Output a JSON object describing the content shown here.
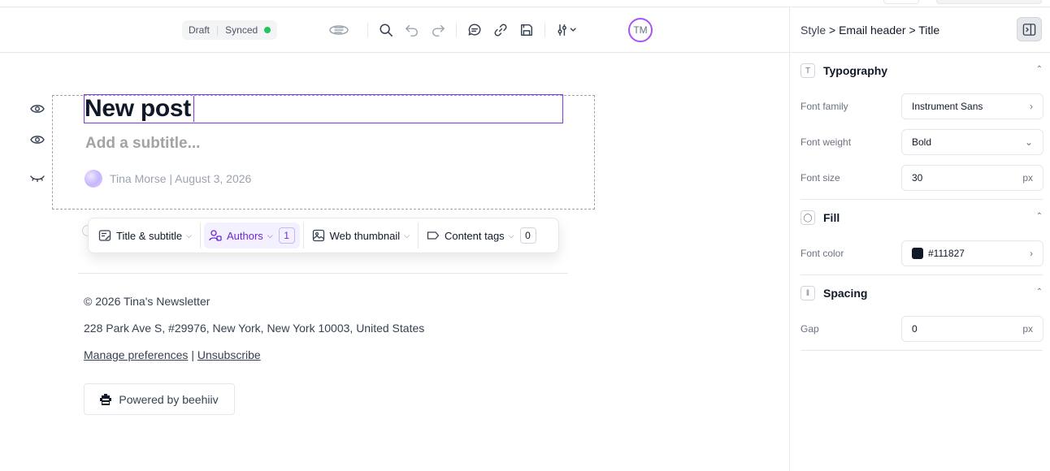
{
  "toolbar": {
    "status_draft": "Draft",
    "status_synced": "Synced",
    "avatar_initials": "TM",
    "icons": [
      "outline-icon",
      "search-icon",
      "undo-icon",
      "redo-icon",
      "comment-icon",
      "link-icon",
      "save-icon",
      "settings-sliders-icon"
    ]
  },
  "post": {
    "title": "New post",
    "subtitle_placeholder": "Add a subtitle...",
    "author_line": "Tina Morse | August 3, 2026"
  },
  "floating_bar": {
    "title_subtitle": "Title & subtitle",
    "authors": "Authors",
    "authors_count": "1",
    "web_thumbnail": "Web thumbnail",
    "content_tags": "Content tags",
    "content_tags_count": "0"
  },
  "footer": {
    "copyright": "© 2026 Tina's Newsletter",
    "address": "228 Park Ave S, #29976, New York, New York 10003, United States",
    "manage_preferences": "Manage preferences",
    "separator": "|",
    "unsubscribe": "Unsubscribe",
    "powered_by": "Powered by beehiiv"
  },
  "panel": {
    "breadcrumb_style": "Style",
    "breadcrumb_rest": " > Email header > Title",
    "typography": {
      "title": "Typography",
      "font_family_label": "Font family",
      "font_family_value": "Instrument Sans",
      "font_weight_label": "Font weight",
      "font_weight_value": "Bold",
      "font_size_label": "Font size",
      "font_size_value": "30",
      "font_size_unit": "px"
    },
    "fill": {
      "title": "Fill",
      "font_color_label": "Font color",
      "font_color_value": "#111827"
    },
    "spacing": {
      "title": "Spacing",
      "gap_label": "Gap",
      "gap_value": "0",
      "gap_unit": "px"
    }
  },
  "colors": {
    "accent": "#7c3aed",
    "synced_dot": "#22c55e",
    "avatar_ring": "#a855f7",
    "text": "#111827"
  }
}
